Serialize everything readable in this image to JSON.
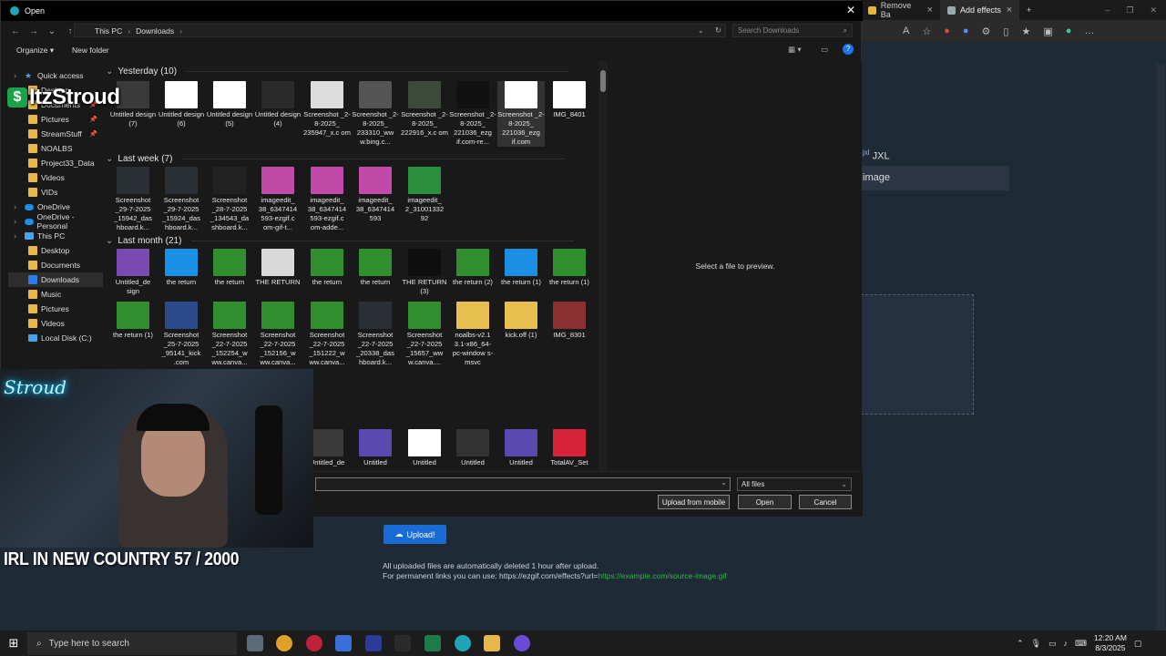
{
  "browser": {
    "tabs": [
      {
        "label": "Remove Ba"
      },
      {
        "label": "Add effects"
      }
    ],
    "jxl_label": "JXL",
    "jxl_sup": "jxl",
    "image_label": "image",
    "upload_button": "Upload!",
    "upload_note_1": "All uploaded files are automatically deleted 1 hour after upload.",
    "upload_note_2_prefix": "For permanent links you can use: https://ezgif.com/effects?url=",
    "upload_note_2_link": "https://example.com/source-image.gif"
  },
  "dialog": {
    "title": "Open",
    "breadcrumb": [
      "This PC",
      "Downloads"
    ],
    "search_placeholder": "Search Downloads",
    "organize_label": "Organize",
    "new_folder_label": "New folder",
    "preview_text": "Select a file to preview.",
    "filetype_value": "All files",
    "upload_mobile_label": "Upload from mobile",
    "open_label": "Open",
    "cancel_label": "Cancel"
  },
  "sidebar": {
    "items": [
      {
        "label": "Quick access",
        "icon": "star-icon",
        "top": true
      },
      {
        "label": "Desktop",
        "icon": "folder-icon"
      },
      {
        "label": "Documents",
        "icon": "folder-icon",
        "pinned": true
      },
      {
        "label": "Pictures",
        "icon": "folder-icon",
        "pinned": true
      },
      {
        "label": "StreamStuff",
        "icon": "folder-icon",
        "pinned": true
      },
      {
        "label": "NOALBS",
        "icon": "folder-icon"
      },
      {
        "label": "Project33_Data",
        "icon": "folder-icon"
      },
      {
        "label": "Videos",
        "icon": "folder-icon"
      },
      {
        "label": "VIDs",
        "icon": "folder-icon"
      },
      {
        "label": "OneDrive",
        "icon": "cloud-icon",
        "top": true
      },
      {
        "label": "OneDrive - Personal",
        "icon": "cloud-icon",
        "top": true
      },
      {
        "label": "This PC",
        "icon": "pc-icon",
        "top": true
      },
      {
        "label": "Desktop",
        "icon": "folder-icon"
      },
      {
        "label": "Documents",
        "icon": "folder-icon"
      },
      {
        "label": "Downloads",
        "icon": "download-icon",
        "selected": true
      },
      {
        "label": "Music",
        "icon": "folder-icon"
      },
      {
        "label": "Pictures",
        "icon": "folder-icon"
      },
      {
        "label": "Videos",
        "icon": "folder-icon"
      },
      {
        "label": "Local Disk (C:)",
        "icon": "drive-icon"
      }
    ]
  },
  "groups": [
    {
      "header": "Yesterday (10)",
      "files": [
        {
          "name": "Untitled design (7)",
          "color": "#3a3a3a"
        },
        {
          "name": "Untitled design (6)",
          "color": "#ffffff"
        },
        {
          "name": "Untitled design (5)",
          "color": "#ffffff"
        },
        {
          "name": "Untitled design (4)",
          "color": "#2a2a2a"
        },
        {
          "name": "Screenshot _2-8-2025_ 235947_x.c om",
          "color": "#dcdcdc"
        },
        {
          "name": "Screenshot _2-8-2025_ 233310_ww w.bing.c...",
          "color": "#555555"
        },
        {
          "name": "Screenshot _2-8-2025_ 222916_x.c om",
          "color": "#3c4a3a"
        },
        {
          "name": "Screenshot _2-8-2025_ 221036_ezg if.com-re...",
          "color": "#111111"
        },
        {
          "name": "Screenshot _2-8-2025_ 221036_ezg if.com",
          "color": "#ffffff",
          "selected": true
        },
        {
          "name": "IMG_8401",
          "color": "#ffffff"
        }
      ]
    },
    {
      "header": "Last week (7)",
      "files": [
        {
          "name": "Screenshot _29-7-2025 _15942_das hboard.k...",
          "color": "#2a2f35"
        },
        {
          "name": "Screenshot _29-7-2025 _15924_das hboard.k...",
          "color": "#2a2f35"
        },
        {
          "name": "Screenshot _28-7-2025 _134543_da shboard.k...",
          "color": "#222222"
        },
        {
          "name": "imageedit_ 38_6347414 593-ezgif.c om-gif-t...",
          "color": "#c04aa8"
        },
        {
          "name": "imageedit_ 38_6347414 593-ezgif.c om-adde...",
          "color": "#c04aa8"
        },
        {
          "name": "imageedit_ 38_6347414 593",
          "color": "#c04aa8"
        },
        {
          "name": "imageedit_ 2_31001332 92",
          "color": "#2a8f3a"
        }
      ]
    },
    {
      "header": "Last month (21)",
      "files": [
        {
          "name": "Untitled_de sign",
          "color": "#7a4ab0"
        },
        {
          "name": "the return",
          "color": "#1a8fe3"
        },
        {
          "name": "the return",
          "color": "#2f8f2f"
        },
        {
          "name": "THE RETURN",
          "color": "#d9d9d9"
        },
        {
          "name": "the return",
          "color": "#2f8f2f"
        },
        {
          "name": "the return",
          "color": "#2f8f2f"
        },
        {
          "name": "THE RETURN (3)",
          "color": "#0f0f0f"
        },
        {
          "name": "the return (2)",
          "color": "#2f8f2f"
        },
        {
          "name": "the return (1)",
          "color": "#1a8fe3"
        },
        {
          "name": "the return (1)",
          "color": "#2f8f2f"
        },
        {
          "name": "the return (1)",
          "color": "#2f8f2f"
        },
        {
          "name": "Screenshot _25-7-2025 _95141_kick .com",
          "color": "#2a4a8a"
        },
        {
          "name": "Screenshot _22-7-2025 _152254_w ww.canva...",
          "color": "#2f8f2f"
        },
        {
          "name": "Screenshot _22-7-2025 _152156_w ww.canva...",
          "color": "#2f8f2f"
        },
        {
          "name": "Screenshot _22-7-2025 _151222_w ww.canva...",
          "color": "#2f8f2f"
        },
        {
          "name": "Screenshot _22-7-2025 _20338_das hboard.k...",
          "color": "#2a2f35"
        },
        {
          "name": "Screenshot _22-7-2025 _15657_ww w.canva....",
          "color": "#2f8f2f"
        },
        {
          "name": "noalbs-v2.1 3.1-x86_64- pc-window s-msvc",
          "color": "#e8c050"
        },
        {
          "name": "kick.off (1)",
          "color": "#e8c050"
        },
        {
          "name": "IMG_8301",
          "color": "#8a3030"
        }
      ]
    },
    {
      "header": "",
      "files": [
        {
          "name": "Untitled_de",
          "color": "#3a3a3a"
        },
        {
          "name": "Untitled",
          "color": "#5a4ab0"
        },
        {
          "name": "Untitled",
          "color": "#ffffff"
        },
        {
          "name": "Untitled",
          "color": "#333333"
        },
        {
          "name": "Untitled",
          "color": "#5a4ab0"
        },
        {
          "name": "TotalAV_Set",
          "color": "#d9233a"
        }
      ]
    }
  ],
  "stream": {
    "logo_badge": "$",
    "logo_name": "ItzStroud",
    "neon_sign": "Stroud",
    "caption": "IRL IN NEW COUNTRY  57 / 2000"
  },
  "taskbar": {
    "search_placeholder": "Type here to search",
    "time": "12:20 AM",
    "date": "8/3/2025"
  }
}
